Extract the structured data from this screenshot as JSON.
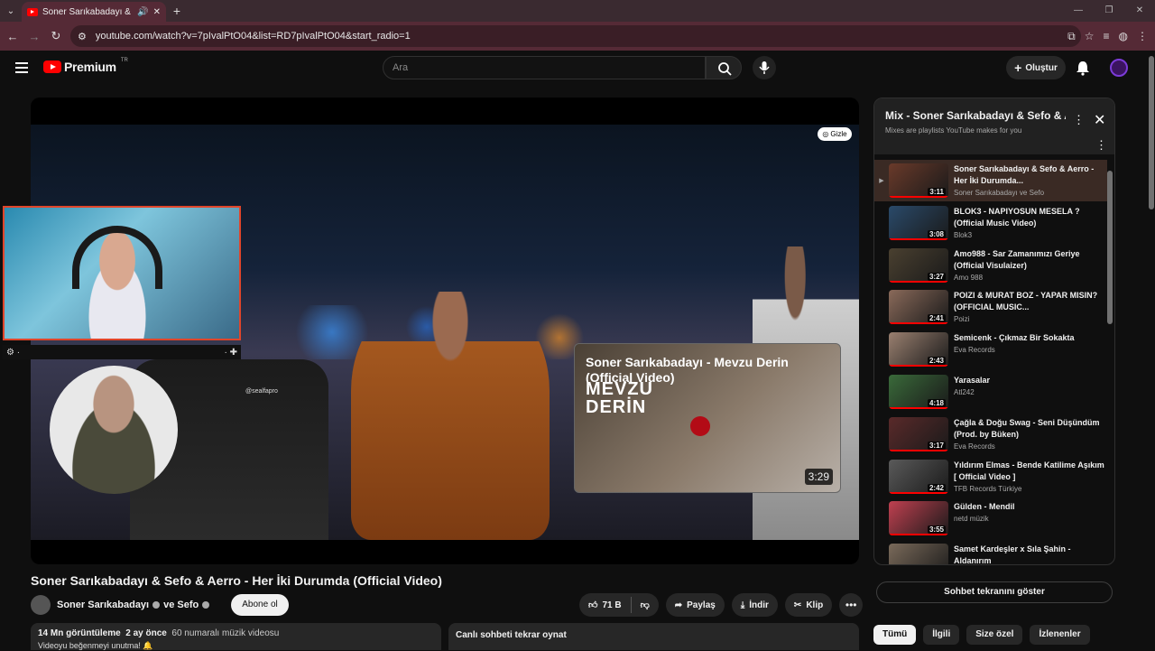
{
  "browser": {
    "tab_title": "Soner Sarıkabadayı & Sefo",
    "url": "youtube.com/watch?v=7pIvalPtO04&list=RD7pIvalPtO04&start_radio=1"
  },
  "masthead": {
    "logo_text": "Premium",
    "region": "TR",
    "search_placeholder": "Ara",
    "create_label": "Oluştur"
  },
  "player": {
    "hide_label": "Gizle",
    "channel_tag": "@sealfapro",
    "endcard": {
      "title": "Soner Sarıkabadayı - Mevzu Derin (Official Video)",
      "art_line1": "MEVZU",
      "art_line2": "DERİN",
      "duration": "3:29"
    }
  },
  "video": {
    "title": "Soner Sarıkabadayı & Sefo & Aerro - Her İki Durumda (Official Video)",
    "channel": "Soner Sarıkabadayı",
    "channel_joiner": "ve Sefo",
    "subscribe_label": "Abone ol",
    "like_count": "71 B",
    "share_label": "Paylaş",
    "download_label": "İndir",
    "clip_label": "Klip",
    "views": "14 Mn görüntüleme",
    "age": "2 ay önce",
    "rank": "60 numaralı müzik videosu",
    "desc_line2": "Videoyu beğenmeyi unutma! 🔔",
    "live_chat_replay": "Canlı sohbeti tekrar oynat"
  },
  "playlist": {
    "title": "Mix - Soner Sarıkabadayı & Sefo & Aerro",
    "subtitle": "Mixes are playlists YouTube makes for you",
    "items": [
      {
        "title": "Soner Sarıkabadayı & Sefo & Aerro - Her İki Durumda...",
        "channel": "Soner Sarıkabadayı ve Sefo",
        "duration": "3:11",
        "active": true,
        "color": "#6a3a2a"
      },
      {
        "title": "BLOK3 - NAPIYOSUN MESELA ? (Official Music Video)",
        "channel": "Blok3",
        "duration": "3:08",
        "color": "#2a4a6a"
      },
      {
        "title": "Amo988 - Sar Zamanımızı Geriye (Official Visulaizer)",
        "channel": "Amo 988",
        "duration": "3:27",
        "color": "#4a4030"
      },
      {
        "title": "POIZI & MURAT BOZ - YAPAR MISIN? (OFFICIAL MUSIC...",
        "channel": "Poizi",
        "duration": "2:41",
        "color": "#8a6a5a"
      },
      {
        "title": "Semicenk - Çıkmaz Bir Sokakta",
        "channel": "Eva Records",
        "duration": "2:43",
        "color": "#9a8070"
      },
      {
        "title": "Yarasalar",
        "channel": "Atl242",
        "duration": "4:18",
        "color": "#3a6a3a"
      },
      {
        "title": "Çağla & Doğu Swag - Seni Düşündüm (Prod. by Büken)",
        "channel": "Eva Records",
        "duration": "3:17",
        "color": "#5a2a2a"
      },
      {
        "title": "Yıldırım Elmas - Bende Katilime Aşıkım [ Official Video ]",
        "channel": "TFB Records Türkiye",
        "duration": "2:42",
        "color": "#5a5a5a"
      },
      {
        "title": "Gülden - Mendil",
        "channel": "netd müzik",
        "duration": "3:55",
        "color": "#c04050"
      },
      {
        "title": "Samet Kardeşler x Sıla Şahin - Aldanırım",
        "channel": "Samet Kardesler",
        "duration": "3:19",
        "color": "#7a6a5a"
      }
    ]
  },
  "sidebar": {
    "show_chat_label": "Sohbet tekranını göster",
    "chips": [
      "Tümü",
      "İlgili",
      "Size özel",
      "İzlenenler"
    ]
  }
}
